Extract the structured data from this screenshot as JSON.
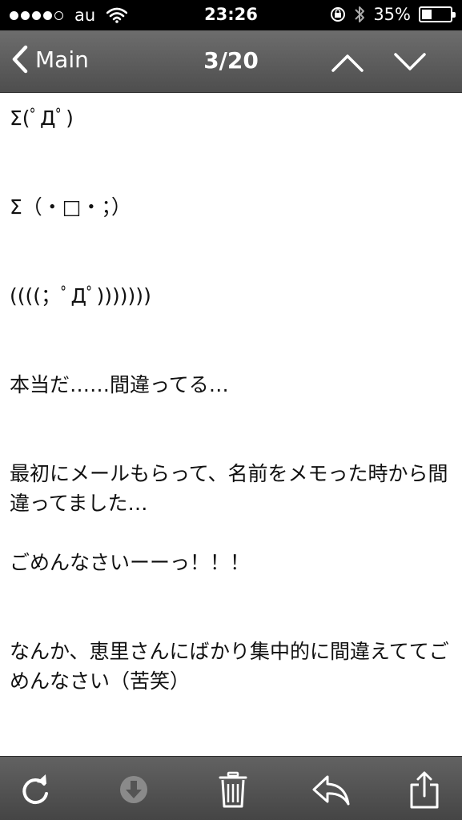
{
  "status_bar": {
    "signal_dots_filled": 4,
    "signal_dots_total": 5,
    "carrier": "au",
    "time": "23:26",
    "battery_percent": "35%",
    "battery_level": 0.35
  },
  "nav": {
    "back_label": "Main",
    "title": "3/20"
  },
  "message": {
    "body": "Σ(ﾟДﾟ)\n\n\nΣ（・□・；）\n\n\n((((；ﾟДﾟ)))))))\n\n\n本当だ……間違ってる…\n\n\n最初にメールもらって、名前をメモった時から間違ってました…\n\nごめんなさいーーっ！！！\n\n\nなんか、恵里さんにばかり集中的に間違えててごめんなさい（苦笑）"
  },
  "toolbar": {
    "icons": [
      "refresh-icon",
      "download-icon",
      "trash-icon",
      "reply-icon",
      "share-icon"
    ]
  },
  "colors": {
    "status_bar_bg": "#000000",
    "nav_bg": "#5c5c5c",
    "toolbar_bg": "#545454",
    "icon_color": "#ffffff",
    "disabled_icon_color": "#8a8a8a"
  }
}
